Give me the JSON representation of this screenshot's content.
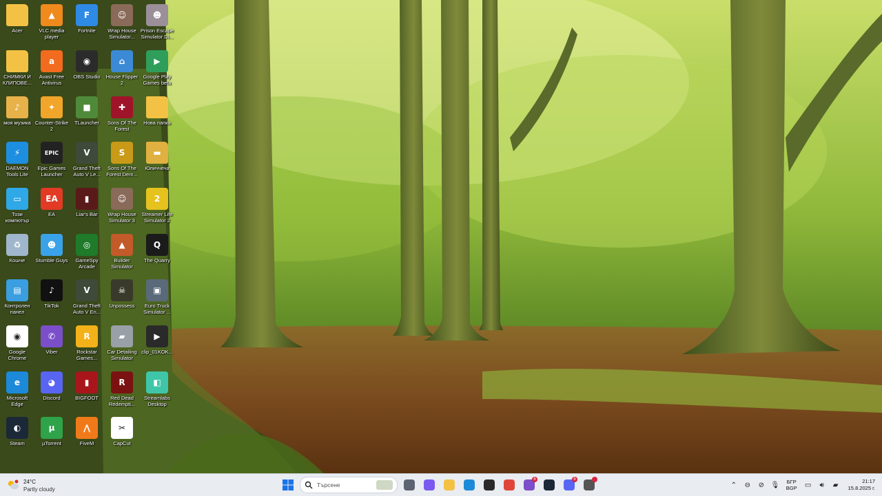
{
  "desktop": {
    "icons": [
      {
        "label": "Acer",
        "color": "#f3c244",
        "glyph": "",
        "kind": "folder-icon"
      },
      {
        "label": "VLC media player",
        "color": "#f08a1c",
        "glyph": "▲",
        "kind": "vlc-icon"
      },
      {
        "label": "Fortnite",
        "color": "#2f8ae5",
        "glyph": "F",
        "kind": "fortnite-icon"
      },
      {
        "label": "Wrap House Simulator...",
        "color": "#8a6a58",
        "glyph": "☺",
        "kind": "game-icon"
      },
      {
        "label": "Prison Escape Simulator Di...",
        "color": "#9b8f9a",
        "glyph": "☻",
        "kind": "game-icon"
      },
      {
        "label": "СНИМКИ И КЛИПОВЕ...",
        "color": "#f3c244",
        "glyph": "",
        "kind": "folder-icon"
      },
      {
        "label": "Avast Free Antivirus",
        "color": "#f26b1e",
        "glyph": "a",
        "kind": "avast-icon"
      },
      {
        "label": "OBS Studio",
        "color": "#2b2b2b",
        "glyph": "◉",
        "kind": "obs-icon"
      },
      {
        "label": "House Flipper 2",
        "color": "#3c8ad6",
        "glyph": "⌂",
        "kind": "game-icon"
      },
      {
        "label": "Google Play Games beta",
        "color": "#2e9e5a",
        "glyph": "▶",
        "kind": "play-games-icon"
      },
      {
        "label": "моя музика",
        "color": "#e8b24a",
        "glyph": "♪",
        "kind": "folder-icon"
      },
      {
        "label": "Counter-Strike 2",
        "color": "#f1a52a",
        "glyph": "✦",
        "kind": "cs2-icon"
      },
      {
        "label": "TLauncher",
        "color": "#4f8a3a",
        "glyph": "■",
        "kind": "tlauncher-icon"
      },
      {
        "label": "Sons Of The Forest",
        "color": "#a0142a",
        "glyph": "✚",
        "kind": "game-icon"
      },
      {
        "label": "Нова папка",
        "color": "#f3c244",
        "glyph": "",
        "kind": "folder-icon"
      },
      {
        "label": "DAEMON Tools Lite",
        "color": "#1e8fe0",
        "glyph": "⚡",
        "kind": "daemon-tools-icon"
      },
      {
        "label": "Epic Games Launcher",
        "color": "#222222",
        "glyph": "EPIC",
        "kind": "epic-games-icon"
      },
      {
        "label": "Grand Theft Auto V Le...",
        "color": "#3f4a3a",
        "glyph": "V",
        "kind": "gta-icon"
      },
      {
        "label": "Sons Of The Forest Dem...",
        "color": "#c89a18",
        "glyph": "S",
        "kind": "game-icon"
      },
      {
        "label": "Юличчеча",
        "color": "#e0b040",
        "glyph": "▬",
        "kind": "folder-icon"
      },
      {
        "label": "Този компютър",
        "color": "#2ea8e6",
        "glyph": "▭",
        "kind": "computer-icon"
      },
      {
        "label": "EA",
        "color": "#e23a24",
        "glyph": "EA",
        "kind": "ea-icon"
      },
      {
        "label": "Liar's Bar",
        "color": "#5a1a1a",
        "glyph": "▮",
        "kind": "game-icon"
      },
      {
        "label": "Wrap House Simulator 3",
        "color": "#8a6a58",
        "glyph": "☺",
        "kind": "game-icon"
      },
      {
        "label": "Streamer Life Simulator 2",
        "color": "#e6c21e",
        "glyph": "2",
        "kind": "game-icon"
      },
      {
        "label": "Кошче",
        "color": "#9fb6cc",
        "glyph": "♻",
        "kind": "recycle-bin-icon"
      },
      {
        "label": "Stumble Guys",
        "color": "#3aa2e8",
        "glyph": "☻",
        "kind": "game-icon"
      },
      {
        "label": "GameSpy Arcade",
        "color": "#1f7a2a",
        "glyph": "◎",
        "kind": "gamespy-icon"
      },
      {
        "label": "Builder Simulator",
        "color": "#c25a2a",
        "glyph": "▲",
        "kind": "game-icon"
      },
      {
        "label": "The Quarry",
        "color": "#1b1b1b",
        "glyph": "Q",
        "kind": "game-icon"
      },
      {
        "label": "Контролен панел",
        "color": "#3a9ee0",
        "glyph": "▤",
        "kind": "control-panel-icon"
      },
      {
        "label": "TikTok",
        "color": "#111111",
        "glyph": "♪",
        "kind": "tiktok-icon"
      },
      {
        "label": "Grand Theft Auto V En...",
        "color": "#3f4a3a",
        "glyph": "V",
        "kind": "gta-icon"
      },
      {
        "label": "Unpossess",
        "color": "#3a3a2a",
        "glyph": "☠",
        "kind": "game-icon"
      },
      {
        "label": "Euro Truck Simulator ...",
        "color": "#5a6a7a",
        "glyph": "▣",
        "kind": "game-icon"
      },
      {
        "label": "Google Chrome",
        "color": "#ffffff",
        "glyph": "◉",
        "kind": "chrome-icon"
      },
      {
        "label": "Viber",
        "color": "#7b4fc9",
        "glyph": "✆",
        "kind": "viber-icon"
      },
      {
        "label": "Rockstar Games...",
        "color": "#f3b21a",
        "glyph": "R",
        "kind": "rockstar-icon"
      },
      {
        "label": "Car Detailing Simulator",
        "color": "#9aa0a8",
        "glyph": "▰",
        "kind": "game-icon"
      },
      {
        "label": "clip_01KOK...",
        "color": "#2a2a2a",
        "glyph": "▶",
        "kind": "video-file-icon"
      },
      {
        "label": "Microsoft Edge",
        "color": "#1c8ad8",
        "glyph": "e",
        "kind": "edge-icon"
      },
      {
        "label": "Discord",
        "color": "#5865f2",
        "glyph": "◕",
        "kind": "discord-icon"
      },
      {
        "label": "BIGFOOT",
        "color": "#a8161c",
        "glyph": "▮",
        "kind": "game-icon"
      },
      {
        "label": "Red Dead Redempti...",
        "color": "#7a1212",
        "glyph": "R",
        "kind": "game-icon"
      },
      {
        "label": "Streamlabs Desktop",
        "color": "#3fc6a8",
        "glyph": "◧",
        "kind": "streamlabs-icon"
      },
      {
        "label": "Steam",
        "color": "#1b2838",
        "glyph": "◐",
        "kind": "steam-icon"
      },
      {
        "label": "µTorrent",
        "color": "#2fa34a",
        "glyph": "µ",
        "kind": "utorrent-icon"
      },
      {
        "label": "FiveM",
        "color": "#f07a1a",
        "glyph": "⋀",
        "kind": "fivem-icon"
      },
      {
        "label": "CapCut",
        "color": "#ffffff",
        "glyph": "✂",
        "kind": "capcut-icon"
      }
    ]
  },
  "taskbar": {
    "weather": {
      "temp": "24°C",
      "condition": "Partly cloudy"
    },
    "search": {
      "placeholder": "Търсене"
    },
    "apps": [
      {
        "name": "task-view-icon",
        "color": "#5b6470"
      },
      {
        "name": "copilot-icon",
        "color": "#7a5af0"
      },
      {
        "name": "file-explorer-icon",
        "color": "#f3c244"
      },
      {
        "name": "edge-icon",
        "color": "#1c8ad8"
      },
      {
        "name": "microsoft-store-icon",
        "color": "#2a2a2a"
      },
      {
        "name": "chrome-icon",
        "color": "#e0453a"
      },
      {
        "name": "viber-icon",
        "color": "#7b4fc9",
        "badge": "6"
      },
      {
        "name": "steam-icon",
        "color": "#1b2838"
      },
      {
        "name": "discord-icon",
        "color": "#5865f2",
        "badge": "6"
      },
      {
        "name": "settings-icon",
        "color": "#555555",
        "badge": ""
      }
    ],
    "language": {
      "line1": "БГР",
      "line2": "BGP"
    },
    "clock": {
      "time": "21:17",
      "date": "15.8.2025 г."
    }
  }
}
